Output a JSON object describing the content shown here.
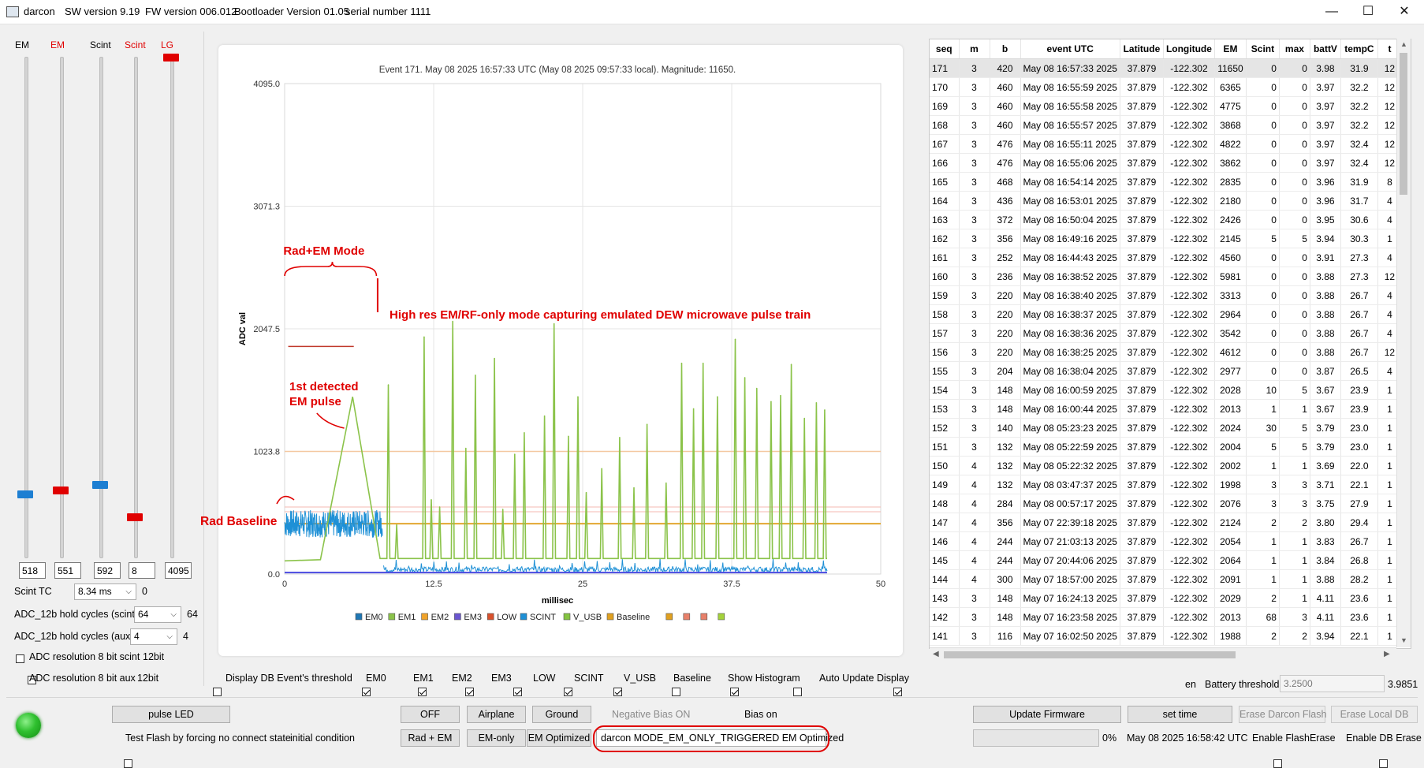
{
  "titlebar": {
    "app": "darcon",
    "sw": "SW version 9.19",
    "fw": "FW version 006.012",
    "boot": "Bootloader Version 01.05",
    "serial": "serial number 1111",
    "min": "—",
    "max": "☐",
    "close": "✕"
  },
  "sliders": [
    {
      "label": "EM",
      "label_color": "#000000",
      "value": "518",
      "level": 0.126,
      "handle_color": "#1e7fd2"
    },
    {
      "label": "EM",
      "label_color": "#e00000",
      "value": "551",
      "level": 0.134,
      "handle_color": "#e00000"
    },
    {
      "label": "Scint",
      "label_color": "#000000",
      "value": "592",
      "level": 0.145,
      "handle_color": "#1e7fd2"
    },
    {
      "label": "Scint",
      "label_color": "#e00000",
      "value": "8",
      "level": 0.08,
      "handle_color": "#e00000"
    },
    {
      "label": "LG",
      "label_color": "#e00000",
      "value": "4095",
      "level": 1.0,
      "handle_color": "#e00000"
    }
  ],
  "settings": {
    "scint_tc_label": "Scint TC",
    "scint_tc_value": "8.34 ms",
    "scint_tc_readout": "0",
    "hold_scint_label": "ADC_12b hold cycles (scint)",
    "hold_scint_value": "64",
    "hold_scint_readout": "64",
    "hold_aux_label": "ADC_12b hold cycles (aux)",
    "hold_aux_value": "4",
    "hold_aux_readout": "4",
    "res_scint_label": "ADC resolution 8 bit scint",
    "res_scint_readout": "12bit",
    "res_aux_label": "ADC resolution 8 bit aux",
    "res_aux_readout": "12bit"
  },
  "chart_data": {
    "type": "line",
    "title": "Event 171. May 08 2025 16:57:33 UTC (May 08 2025 09:57:33 local). Magnitude: 11650.",
    "xlabel": "millisec",
    "ylabel": "ADC val",
    "xlim": [
      0,
      50
    ],
    "ylim": [
      0,
      4095
    ],
    "xticks": [
      "0",
      "12.5",
      "25",
      "37.5",
      "50"
    ],
    "yticks": [
      "0.0",
      "1023.8",
      "2047.5",
      "3071.3",
      "4095.0"
    ],
    "grid": true,
    "legend_position": "bottom",
    "legend": [
      {
        "name": "EM0",
        "color": "#1f77b4"
      },
      {
        "name": "EM1",
        "color": "#8bc34a"
      },
      {
        "name": "EM2",
        "color": "#f0a32a"
      },
      {
        "name": "EM3",
        "color": "#6a55d0"
      },
      {
        "name": "LOW",
        "color": "#d9512c"
      },
      {
        "name": "SCINT",
        "color": "#1e90d6"
      },
      {
        "name": "V_USB",
        "color": "#84c441"
      },
      {
        "name": "Baseline",
        "color": "#e0a020"
      },
      {
        "name": "",
        "color": "#e0a020"
      },
      {
        "name": "",
        "color": "#e8806a"
      },
      {
        "name": "",
        "color": "#e8806a"
      },
      {
        "name": "",
        "color": "#a4d23a"
      }
    ],
    "baseline_y": 420,
    "threshold_lines": [
      1023.8,
      560,
      520
    ],
    "em1_baseline": 130,
    "em1_ramp": {
      "x": [
        0,
        3,
        5.7,
        8,
        8.5
      ],
      "y": [
        110,
        120,
        1480,
        130,
        130
      ]
    },
    "pulses": [
      {
        "x": 8.7,
        "y": 1580
      },
      {
        "x": 9.4,
        "y": 410
      },
      {
        "x": 11.7,
        "y": 1980
      },
      {
        "x": 12.3,
        "y": 620
      },
      {
        "x": 13.0,
        "y": 560
      },
      {
        "x": 14.1,
        "y": 2110
      },
      {
        "x": 15.2,
        "y": 1050
      },
      {
        "x": 16.0,
        "y": 1660
      },
      {
        "x": 17.6,
        "y": 1800
      },
      {
        "x": 18.3,
        "y": 540
      },
      {
        "x": 19.3,
        "y": 1000
      },
      {
        "x": 20.1,
        "y": 1180
      },
      {
        "x": 21.8,
        "y": 1320
      },
      {
        "x": 22.6,
        "y": 2090
      },
      {
        "x": 23.8,
        "y": 1150
      },
      {
        "x": 24.6,
        "y": 1480
      },
      {
        "x": 25.3,
        "y": 680
      },
      {
        "x": 26.6,
        "y": 880
      },
      {
        "x": 28.1,
        "y": 1140
      },
      {
        "x": 29.3,
        "y": 720
      },
      {
        "x": 30.4,
        "y": 1250
      },
      {
        "x": 32.0,
        "y": 760
      },
      {
        "x": 33.3,
        "y": 1760
      },
      {
        "x": 34.3,
        "y": 1380
      },
      {
        "x": 35.1,
        "y": 1760
      },
      {
        "x": 36.3,
        "y": 1480
      },
      {
        "x": 37.8,
        "y": 1960
      },
      {
        "x": 38.6,
        "y": 1640
      },
      {
        "x": 39.6,
        "y": 1550
      },
      {
        "x": 40.8,
        "y": 1440
      },
      {
        "x": 41.6,
        "y": 1490
      },
      {
        "x": 42.5,
        "y": 1750
      },
      {
        "x": 43.6,
        "y": 1300
      },
      {
        "x": 44.6,
        "y": 1430
      },
      {
        "x": 45.3,
        "y": 1370
      }
    ],
    "annotations": {
      "mode": "Rad+EM Mode",
      "highres": "High res EM/RF-only mode capturing emulated DEW microwave pulse train",
      "first_pulse": "1st detected\nEM pulse",
      "baseline": "Rad Baseline"
    }
  },
  "display_options": [
    {
      "label": "Display DB Event's threshold",
      "checked": false
    },
    {
      "label": "EM0",
      "checked": true
    },
    {
      "label": "EM1",
      "checked": true
    },
    {
      "label": "EM2",
      "checked": true
    },
    {
      "label": "EM3",
      "checked": true
    },
    {
      "label": "LOW",
      "checked": true
    },
    {
      "label": "SCINT",
      "checked": true
    },
    {
      "label": "V_USB",
      "checked": false
    },
    {
      "label": "Baseline",
      "checked": true
    },
    {
      "label": "Show Histogram",
      "checked": false
    },
    {
      "label": "Auto Update Display",
      "checked": true
    }
  ],
  "table": {
    "columns": [
      "seq",
      "m",
      "b",
      "event UTC",
      "Latitude",
      "Longitude",
      "EM",
      "Scint",
      "max",
      "battV",
      "tempC",
      "t"
    ],
    "rows": [
      [
        "171",
        "3",
        "420",
        "May 08 16:57:33 2025",
        "37.879",
        "-122.302",
        "11650",
        "0",
        "0",
        "3.98",
        "31.9",
        "12"
      ],
      [
        "170",
        "3",
        "460",
        "May 08 16:55:59 2025",
        "37.879",
        "-122.302",
        "6365",
        "0",
        "0",
        "3.97",
        "32.2",
        "12"
      ],
      [
        "169",
        "3",
        "460",
        "May 08 16:55:58 2025",
        "37.879",
        "-122.302",
        "4775",
        "0",
        "0",
        "3.97",
        "32.2",
        "12"
      ],
      [
        "168",
        "3",
        "460",
        "May 08 16:55:57 2025",
        "37.879",
        "-122.302",
        "3868",
        "0",
        "0",
        "3.97",
        "32.2",
        "12"
      ],
      [
        "167",
        "3",
        "476",
        "May 08 16:55:11 2025",
        "37.879",
        "-122.302",
        "4822",
        "0",
        "0",
        "3.97",
        "32.4",
        "12"
      ],
      [
        "166",
        "3",
        "476",
        "May 08 16:55:06 2025",
        "37.879",
        "-122.302",
        "3862",
        "0",
        "0",
        "3.97",
        "32.4",
        "12"
      ],
      [
        "165",
        "3",
        "468",
        "May 08 16:54:14 2025",
        "37.879",
        "-122.302",
        "2835",
        "0",
        "0",
        "3.96",
        "31.9",
        "8"
      ],
      [
        "164",
        "3",
        "436",
        "May 08 16:53:01 2025",
        "37.879",
        "-122.302",
        "2180",
        "0",
        "0",
        "3.96",
        "31.7",
        "4"
      ],
      [
        "163",
        "3",
        "372",
        "May 08 16:50:04 2025",
        "37.879",
        "-122.302",
        "2426",
        "0",
        "0",
        "3.95",
        "30.6",
        "4"
      ],
      [
        "162",
        "3",
        "356",
        "May 08 16:49:16 2025",
        "37.879",
        "-122.302",
        "2145",
        "5",
        "5",
        "3.94",
        "30.3",
        "1"
      ],
      [
        "161",
        "3",
        "252",
        "May 08 16:44:43 2025",
        "37.879",
        "-122.302",
        "4560",
        "0",
        "0",
        "3.91",
        "27.3",
        "4"
      ],
      [
        "160",
        "3",
        "236",
        "May 08 16:38:52 2025",
        "37.879",
        "-122.302",
        "5981",
        "0",
        "0",
        "3.88",
        "27.3",
        "12"
      ],
      [
        "159",
        "3",
        "220",
        "May 08 16:38:40 2025",
        "37.879",
        "-122.302",
        "3313",
        "0",
        "0",
        "3.88",
        "26.7",
        "4"
      ],
      [
        "158",
        "3",
        "220",
        "May 08 16:38:37 2025",
        "37.879",
        "-122.302",
        "2964",
        "0",
        "0",
        "3.88",
        "26.7",
        "4"
      ],
      [
        "157",
        "3",
        "220",
        "May 08 16:38:36 2025",
        "37.879",
        "-122.302",
        "3542",
        "0",
        "0",
        "3.88",
        "26.7",
        "4"
      ],
      [
        "156",
        "3",
        "220",
        "May 08 16:38:25 2025",
        "37.879",
        "-122.302",
        "4612",
        "0",
        "0",
        "3.88",
        "26.7",
        "12"
      ],
      [
        "155",
        "3",
        "204",
        "May 08 16:38:04 2025",
        "37.879",
        "-122.302",
        "2977",
        "0",
        "0",
        "3.87",
        "26.5",
        "4"
      ],
      [
        "154",
        "3",
        "148",
        "May 08 16:00:59 2025",
        "37.879",
        "-122.302",
        "2028",
        "10",
        "5",
        "3.67",
        "23.9",
        "1"
      ],
      [
        "153",
        "3",
        "148",
        "May 08 16:00:44 2025",
        "37.879",
        "-122.302",
        "2013",
        "1",
        "1",
        "3.67",
        "23.9",
        "1"
      ],
      [
        "152",
        "3",
        "140",
        "May 08 05:23:23 2025",
        "37.879",
        "-122.302",
        "2024",
        "30",
        "5",
        "3.79",
        "23.0",
        "1"
      ],
      [
        "151",
        "3",
        "132",
        "May 08 05:22:59 2025",
        "37.879",
        "-122.302",
        "2004",
        "5",
        "5",
        "3.79",
        "23.0",
        "1"
      ],
      [
        "150",
        "4",
        "132",
        "May 08 05:22:32 2025",
        "37.879",
        "-122.302",
        "2002",
        "1",
        "1",
        "3.69",
        "22.0",
        "1"
      ],
      [
        "149",
        "4",
        "132",
        "May 08 03:47:37 2025",
        "37.879",
        "-122.302",
        "1998",
        "3",
        "3",
        "3.71",
        "22.1",
        "1"
      ],
      [
        "148",
        "4",
        "284",
        "May 08 00:57:17 2025",
        "37.879",
        "-122.302",
        "2076",
        "3",
        "3",
        "3.75",
        "27.9",
        "1"
      ],
      [
        "147",
        "4",
        "356",
        "May 07 22:39:18 2025",
        "37.879",
        "-122.302",
        "2124",
        "2",
        "2",
        "3.80",
        "29.4",
        "1"
      ],
      [
        "146",
        "4",
        "244",
        "May 07 21:03:13 2025",
        "37.879",
        "-122.302",
        "2054",
        "1",
        "1",
        "3.83",
        "26.7",
        "1"
      ],
      [
        "145",
        "4",
        "244",
        "May 07 20:44:06 2025",
        "37.879",
        "-122.302",
        "2064",
        "1",
        "1",
        "3.84",
        "26.8",
        "1"
      ],
      [
        "144",
        "4",
        "300",
        "May 07 18:57:00 2025",
        "37.879",
        "-122.302",
        "2091",
        "1",
        "1",
        "3.88",
        "28.2",
        "1"
      ],
      [
        "143",
        "3",
        "148",
        "May 07 16:24:13 2025",
        "37.879",
        "-122.302",
        "2029",
        "2",
        "1",
        "4.11",
        "23.6",
        "1"
      ],
      [
        "142",
        "3",
        "148",
        "May 07 16:23:58 2025",
        "37.879",
        "-122.302",
        "2013",
        "68",
        "3",
        "4.11",
        "23.6",
        "1"
      ],
      [
        "141",
        "3",
        "116",
        "May 07 16:02:50 2025",
        "37.879",
        "-122.302",
        "1988",
        "2",
        "2",
        "3.94",
        "22.1",
        "1"
      ]
    ]
  },
  "battery": {
    "en_label": "en",
    "label": "Battery threshold",
    "value": "3.2500",
    "readout": "3.9851"
  },
  "bottom": {
    "pulse_led": "pulse LED",
    "test_flash": "Test Flash by forcing no connect state",
    "initial_condition": "initial condition",
    "off": "OFF",
    "airplane": "Airplane",
    "ground": "Ground",
    "rad_em": "Rad + EM",
    "em_only": "EM-only",
    "em_optimized": "EM Optimized",
    "negative_bias": "Negative Bias ON",
    "bias_status": "Bias on",
    "mode_status": "darcon MODE_EM_ONLY_TRIGGERED  EM Optimized",
    "update_fw": "Update Firmware",
    "set_time": "set time",
    "erase_darcon": "Erase Darcon Flash",
    "erase_local": "Erase Local DB",
    "progress_pct": "0%",
    "progress": 0,
    "time": "May 08 2025 16:58:42 UTC",
    "enable_flash_erase": "Enable FlashErase",
    "enable_db_erase": "Enable DB Erase"
  }
}
